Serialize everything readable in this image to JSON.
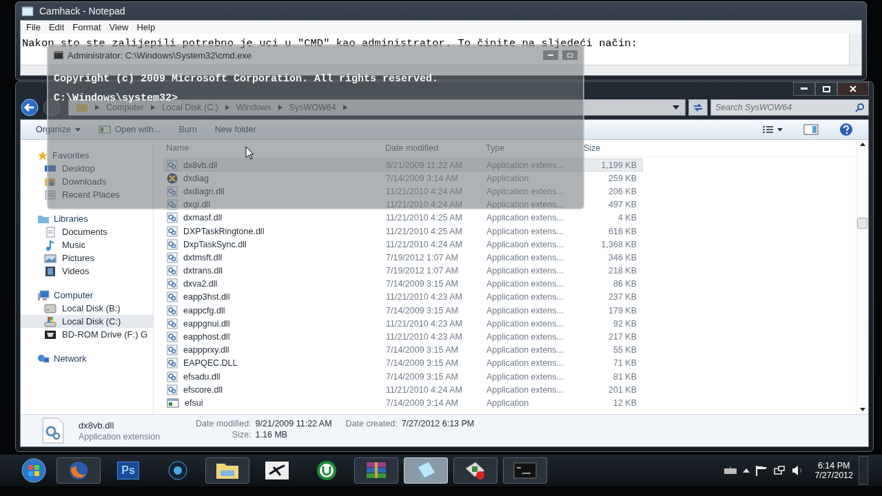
{
  "notepad": {
    "title": "Camhack - Notepad",
    "menu": [
      "File",
      "Edit",
      "Format",
      "View",
      "Help"
    ],
    "text": "Nakon sto ste zalijepili potrebno je uci u \"CMD\" kao administrator. To činite na sljedeći način:"
  },
  "cmd": {
    "title": "Administrator: C:\\Windows\\System32\\cmd.exe",
    "lines": [
      "Copyright (c) 2009 Microsoft Corporation.  All rights reserved.",
      "C:\\Windows\\system32>"
    ]
  },
  "explorer": {
    "breadcrumb": [
      "Computer",
      "Local Disk (C:)",
      "Windows",
      "SysWOW64"
    ],
    "search": {
      "placeholder": "Search SysWOW64"
    },
    "toolbar": [
      "Organize",
      "Open with...",
      "Burn",
      "New folder"
    ],
    "sidebar": [
      {
        "label": "Favorites",
        "children": [
          {
            "label": "Desktop",
            "selected": false
          },
          {
            "label": "Downloads",
            "selected": false
          },
          {
            "label": "Recent Places",
            "selected": false
          }
        ]
      },
      {
        "label": "Libraries",
        "children": [
          {
            "label": "Documents",
            "selected": false
          },
          {
            "label": "Music",
            "selected": false
          },
          {
            "label": "Pictures",
            "selected": false
          },
          {
            "label": "Videos",
            "selected": false
          }
        ]
      },
      {
        "label": "Computer",
        "children": [
          {
            "label": "Local Disk (B:)",
            "selected": false
          },
          {
            "label": "Local Disk (C:)",
            "selected": true
          },
          {
            "label": "BD-ROM Drive (F:) G",
            "selected": false
          }
        ]
      },
      {
        "label": "Network"
      }
    ],
    "columns": [
      "Name",
      "Date modified",
      "Type",
      "Size"
    ],
    "rows": [
      {
        "kind": "dll",
        "name": "dx8vb.dll",
        "date": "9/21/2009 11:22 AM",
        "type": "Application extens...",
        "size": "1,199 KB",
        "selected": true
      },
      {
        "kind": "diag",
        "name": "dxdiag",
        "date": "7/14/2009 3:14 AM",
        "type": "Application",
        "size": "259 KB",
        "selected": false
      },
      {
        "kind": "dll",
        "name": "dxdiagn.dll",
        "date": "11/21/2010 4:24 AM",
        "type": "Application extens...",
        "size": "206 KB",
        "selected": false
      },
      {
        "kind": "dll",
        "name": "dxgi.dll",
        "date": "11/21/2010 4:24 AM",
        "type": "Application extens...",
        "size": "497 KB",
        "selected": false
      },
      {
        "kind": "dll",
        "name": "dxmasf.dll",
        "date": "11/21/2010 4:25 AM",
        "type": "Application extens...",
        "size": "4 KB",
        "selected": false
      },
      {
        "kind": "dll",
        "name": "DXPTaskRingtone.dll",
        "date": "11/21/2010 4:25 AM",
        "type": "Application extens...",
        "size": "616 KB",
        "selected": false
      },
      {
        "kind": "dll",
        "name": "DxpTaskSync.dll",
        "date": "11/21/2010 4:24 AM",
        "type": "Application extens...",
        "size": "1,368 KB",
        "selected": false
      },
      {
        "kind": "dll",
        "name": "dxtmsft.dll",
        "date": "7/19/2012 1:07 AM",
        "type": "Application extens...",
        "size": "346 KB",
        "selected": false
      },
      {
        "kind": "dll",
        "name": "dxtrans.dll",
        "date": "7/19/2012 1:07 AM",
        "type": "Application extens...",
        "size": "218 KB",
        "selected": false
      },
      {
        "kind": "dll",
        "name": "dxva2.dll",
        "date": "7/14/2009 3:15 AM",
        "type": "Application extens...",
        "size": "86 KB",
        "selected": false
      },
      {
        "kind": "dll",
        "name": "eapp3hst.dll",
        "date": "11/21/2010 4:23 AM",
        "type": "Application extens...",
        "size": "237 KB",
        "selected": false
      },
      {
        "kind": "dll",
        "name": "eappcfg.dll",
        "date": "7/14/2009 3:15 AM",
        "type": "Application extens...",
        "size": "179 KB",
        "selected": false
      },
      {
        "kind": "dll",
        "name": "eappgnui.dll",
        "date": "11/21/2010 4:23 AM",
        "type": "Application extens...",
        "size": "92 KB",
        "selected": false
      },
      {
        "kind": "dll",
        "name": "eapphost.dll",
        "date": "11/21/2010 4:23 AM",
        "type": "Application extens...",
        "size": "217 KB",
        "selected": false
      },
      {
        "kind": "dll",
        "name": "eappprxy.dll",
        "date": "7/14/2009 3:15 AM",
        "type": "Application extens...",
        "size": "55 KB",
        "selected": false
      },
      {
        "kind": "dll",
        "name": "EAPQEC.DLL",
        "date": "7/14/2009 3:15 AM",
        "type": "Application extens...",
        "size": "71 KB",
        "selected": false
      },
      {
        "kind": "dll",
        "name": "efsadu.dll",
        "date": "7/14/2009 3:15 AM",
        "type": "Application extens...",
        "size": "81 KB",
        "selected": false
      },
      {
        "kind": "dll",
        "name": "efscore.dll",
        "date": "11/21/2010 4:24 AM",
        "type": "Application extens...",
        "size": "201 KB",
        "selected": false
      },
      {
        "kind": "window",
        "name": "efsui",
        "date": "7/14/2009 3:14 AM",
        "type": "Application",
        "size": "12 KB",
        "selected": false
      }
    ],
    "details": {
      "name": "dx8vb.dll",
      "type": "Application extension",
      "modified_label": "Date modified:",
      "modified": "9/21/2009 11:22 AM",
      "size_label": "Size:",
      "size": "1.16 MB",
      "created_label": "Date created:",
      "created": "7/27/2012 6:13 PM"
    }
  },
  "taskbar": {
    "apps": [
      {
        "running": true,
        "active": false
      },
      {
        "running": false,
        "active": false,
        "label": "Ps"
      },
      {
        "running": false,
        "active": false
      },
      {
        "running": true,
        "active": false
      },
      {
        "running": false,
        "active": false
      },
      {
        "running": false,
        "active": false
      },
      {
        "running": true,
        "active": false
      },
      {
        "running": true,
        "active": true
      },
      {
        "running": true,
        "active": false
      },
      {
        "running": true,
        "active": false
      }
    ],
    "time": "6:14 PM",
    "date": "7/27/2012"
  }
}
